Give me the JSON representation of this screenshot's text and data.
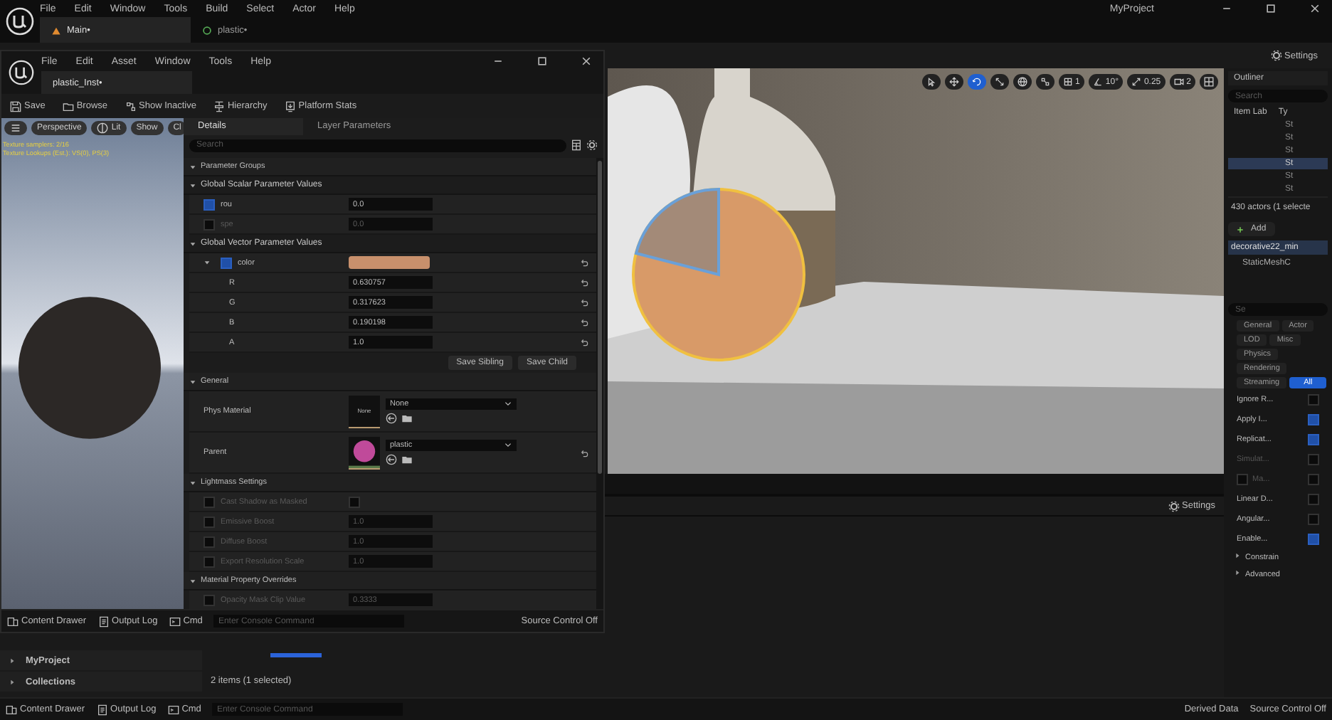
{
  "main_window": {
    "menu": [
      "File",
      "Edit",
      "Window",
      "Tools",
      "Build",
      "Select",
      "Actor",
      "Help"
    ],
    "project": "MyProject",
    "tabs": [
      {
        "label": "Main•",
        "kind": "level",
        "selected": true
      },
      {
        "label": "plastic•",
        "kind": "material",
        "selected": false
      }
    ],
    "settings": "Settings"
  },
  "viewport": {
    "tools": [
      {
        "kind": "select",
        "selected": false
      },
      {
        "kind": "move",
        "selected": false
      },
      {
        "kind": "rotate",
        "selected": true
      },
      {
        "kind": "scale",
        "selected": false
      },
      {
        "kind": "globe",
        "selected": false
      },
      {
        "kind": "snap",
        "selected": false
      },
      {
        "kind": "grid",
        "label": "1",
        "selected": false
      },
      {
        "kind": "angle",
        "label": "10°",
        "selected": false
      },
      {
        "kind": "scale-snap",
        "label": "0.25",
        "selected": false
      },
      {
        "kind": "camera",
        "label": "2",
        "selected": false
      },
      {
        "kind": "layout",
        "selected": false
      }
    ]
  },
  "material_editor": {
    "menu": [
      "File",
      "Edit",
      "Asset",
      "Window",
      "Tools",
      "Help"
    ],
    "tab": "plastic_Inst•",
    "toolbar": [
      {
        "kind": "save",
        "label": "Save"
      },
      {
        "kind": "browse",
        "label": "Browse"
      },
      {
        "kind": "inactive",
        "label": "Show Inactive"
      },
      {
        "kind": "hierarchy",
        "label": "Hierarchy"
      },
      {
        "kind": "stats",
        "label": "Platform Stats"
      }
    ],
    "preview": {
      "buttons": [
        {
          "kind": "menu"
        },
        {
          "kind": "text",
          "label": "Perspective"
        },
        {
          "kind": "lit",
          "label": "Lit"
        },
        {
          "kind": "text",
          "label": "Show"
        },
        {
          "kind": "text",
          "label": "Cl"
        }
      ],
      "stats": [
        "Texture samplers: 2/16",
        "Texture Lookups (Est.): VS(0), PS(3)"
      ]
    },
    "details": {
      "tabs": [
        {
          "label": "Details",
          "selected": true
        },
        {
          "label": "Layer Parameters",
          "selected": false
        }
      ],
      "search": {
        "placeholder": "Search"
      },
      "sections": [
        {
          "title": "Parameter Groups",
          "kind": "group"
        },
        {
          "title": "Global Scalar Parameter Values",
          "kind": "section",
          "rows": [
            {
              "kind": "param",
              "label": "rou",
              "checked": true,
              "value": "0.0",
              "reset": false
            },
            {
              "kind": "param",
              "label": "spe",
              "checked": false,
              "value": "0.0",
              "reset": false
            }
          ]
        },
        {
          "title": "Global Vector Parameter Values",
          "kind": "section",
          "rows": [
            {
              "kind": "color",
              "label": "color",
              "checked": true,
              "color": "#c8906c",
              "reset": true
            },
            {
              "kind": "channel",
              "label": "R",
              "value": "0.630757",
              "reset": true
            },
            {
              "kind": "channel",
              "label": "G",
              "value": "0.317623",
              "reset": true
            },
            {
              "kind": "channel",
              "label": "B",
              "value": "0.190198",
              "reset": true
            },
            {
              "kind": "channel",
              "label": "A",
              "value": "1.0",
              "reset": true
            },
            {
              "kind": "buttons",
              "labels": [
                "Save Sibling",
                "Save Child"
              ]
            }
          ]
        },
        {
          "title": "General",
          "kind": "group",
          "rows": [
            {
              "kind": "asset",
              "label": "Phys Material",
              "thumbnail": {
                "kind": "text",
                "label": "None"
              },
              "value": "None",
              "reset": false
            },
            {
              "kind": "asset",
              "label": "Parent",
              "thumbnail": {
                "kind": "sphere"
              },
              "value": "plastic",
              "reset": true
            }
          ]
        },
        {
          "title": "Lightmass Settings",
          "kind": "group",
          "rows": [
            {
              "kind": "check",
              "label": "Cast Shadow as Masked",
              "checked": false,
              "value_checked": false,
              "reset": false
            },
            {
              "kind": "param",
              "label": "Emissive Boost",
              "checked": false,
              "value": "1.0",
              "reset": false
            },
            {
              "kind": "param",
              "label": "Diffuse Boost",
              "checked": false,
              "value": "1.0",
              "reset": false
            },
            {
              "kind": "param",
              "label": "Export Resolution Scale",
              "checked": false,
              "value": "1.0",
              "reset": false
            }
          ]
        },
        {
          "title": "Material Property Overrides",
          "kind": "group",
          "rows": [
            {
              "kind": "param",
              "label": "Opacity Mask Clip Value",
              "checked": false,
              "value": "0.3333",
              "reset": false
            }
          ]
        }
      ]
    },
    "status_bar": {
      "items": [
        {
          "kind": "drawer",
          "label": "Content Drawer"
        },
        {
          "kind": "log",
          "label": "Output Log"
        },
        {
          "kind": "cmd",
          "label": "Cmd"
        }
      ],
      "console": {
        "placeholder": "Enter Console Command"
      },
      "source_control": "Source Control Off"
    }
  },
  "content_browser": {
    "settings": "Settings",
    "sources": [
      "MyProject",
      "Collections"
    ],
    "count": "2 items (1 selected)"
  },
  "outliner": {
    "title": "Outliner",
    "search": {
      "placeholder": "Search"
    },
    "columns": [
      "Item Lab",
      "Ty"
    ],
    "rows": [
      {
        "label": "St",
        "selected": false
      },
      {
        "label": "St",
        "selected": false
      },
      {
        "label": "St",
        "selected": false
      },
      {
        "label": "St",
        "selected": true
      },
      {
        "label": "St",
        "selected": false
      },
      {
        "label": "St",
        "selected": false
      }
    ],
    "count": "430 actors (1 selecte",
    "add": "Add",
    "components": [
      {
        "label": "decorative22_min",
        "selected": true
      },
      {
        "label": "StaticMeshC",
        "selected": false
      }
    ],
    "details_search": {
      "placeholder": "Se"
    },
    "categories": [
      {
        "label": "General",
        "selected": false
      },
      {
        "label": "Actor",
        "selected": false
      },
      {
        "label": "LOD",
        "selected": false
      },
      {
        "label": "Misc",
        "selected": false
      },
      {
        "label": "Physics",
        "selected": false
      },
      {
        "label": "Rendering",
        "selected": false
      },
      {
        "label": "Streaming",
        "selected": false
      },
      {
        "label": "All",
        "selected": true
      }
    ],
    "properties": [
      {
        "kind": "plain",
        "label": "Ignore R...",
        "checked": false,
        "disabled": false
      },
      {
        "kind": "plain",
        "label": "Apply I...",
        "checked": true,
        "disabled": false
      },
      {
        "kind": "plain",
        "label": "Replicat...",
        "checked": true,
        "disabled": false
      },
      {
        "kind": "plain",
        "label": "Simulat...",
        "checked": false,
        "disabled": true
      },
      {
        "kind": "toggle",
        "label": "Ma...",
        "toggle_checked": false,
        "checked": false,
        "disabled": true
      },
      {
        "kind": "plain",
        "label": "Linear D...",
        "checked": false,
        "disabled": false
      },
      {
        "kind": "plain",
        "label": "Angular...",
        "checked": false,
        "disabled": false
      },
      {
        "kind": "plain",
        "label": "Enable...",
        "checked": true,
        "disabled": false
      }
    ],
    "sections": [
      {
        "label": "Constrain",
        "expanded": false
      },
      {
        "label": "Advanced",
        "expanded": false
      }
    ]
  },
  "status_bar": {
    "items": [
      {
        "kind": "drawer",
        "label": "Content Drawer"
      },
      {
        "kind": "log",
        "label": "Output Log"
      },
      {
        "kind": "cmd",
        "label": "Cmd"
      }
    ],
    "console": {
      "placeholder": "Enter Console Command"
    },
    "derived": "Derived Data",
    "source_control": "Source Control Off"
  }
}
